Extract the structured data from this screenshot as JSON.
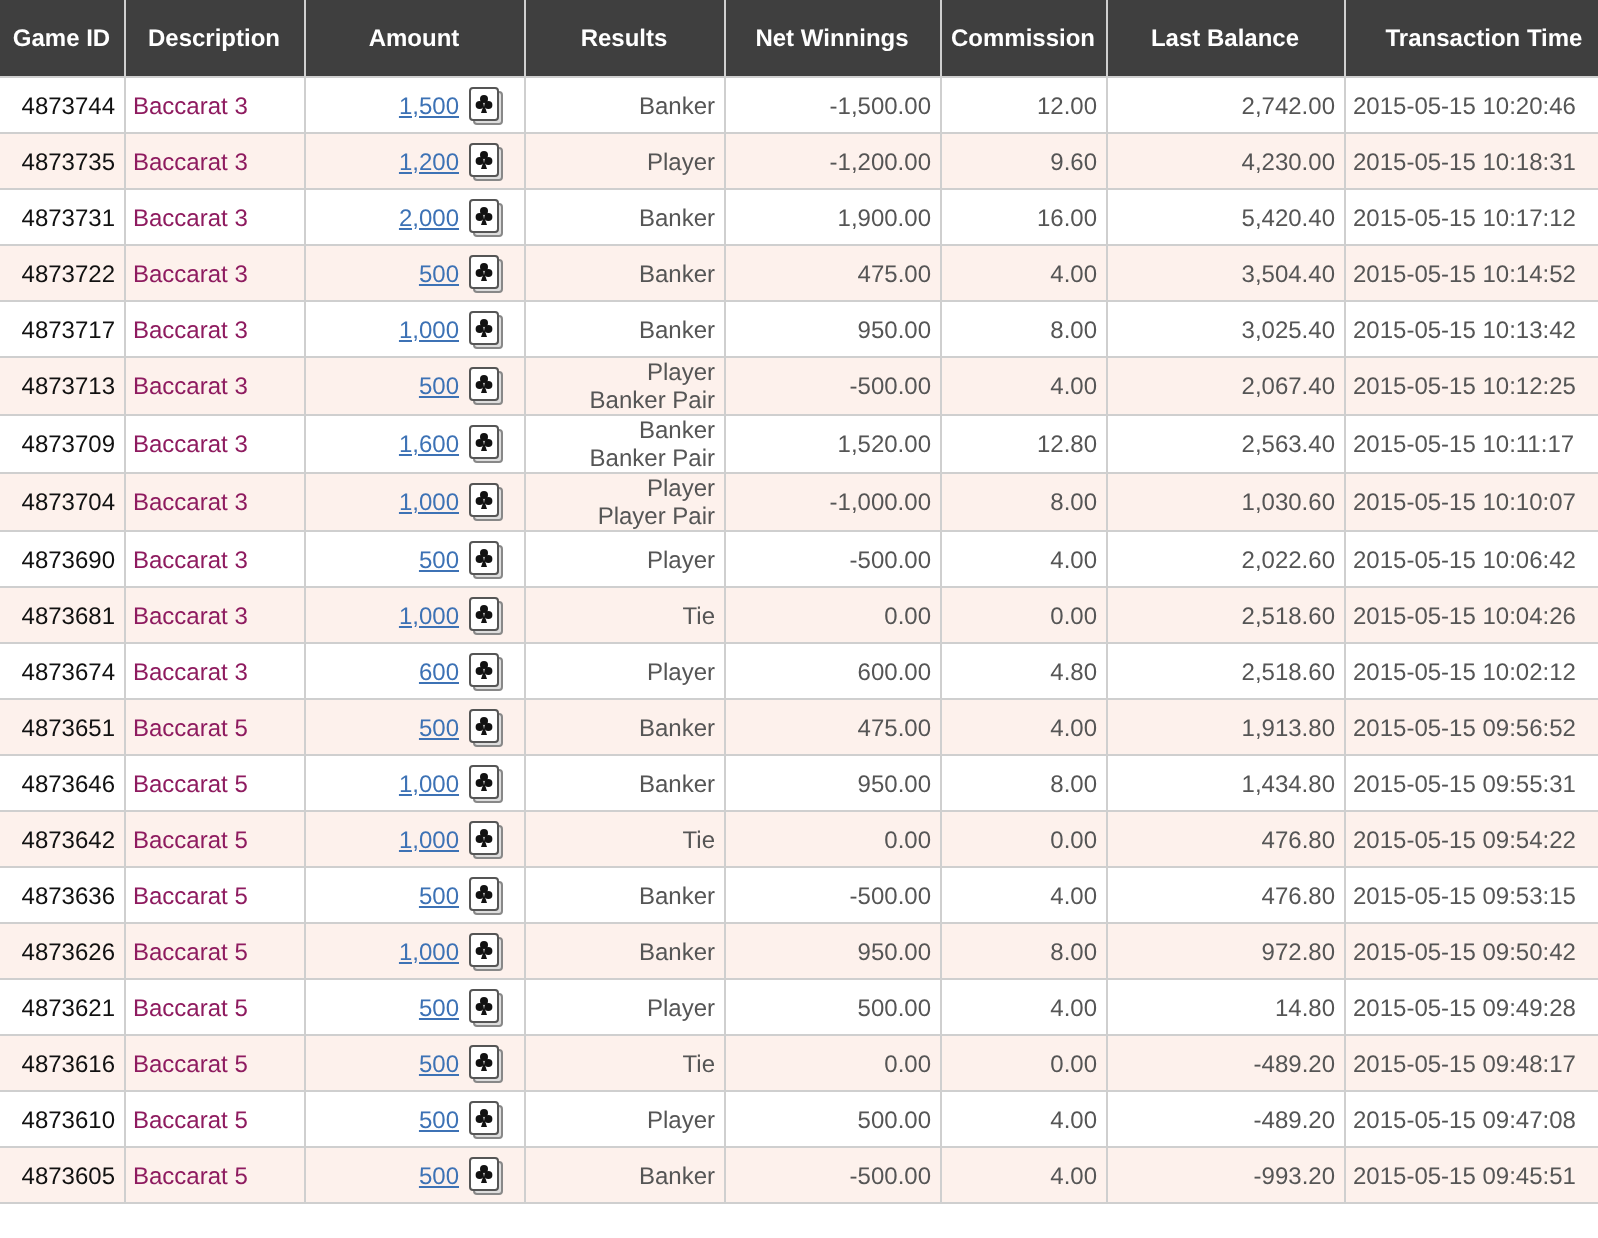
{
  "table": {
    "columns": [
      "Game ID",
      "Description",
      "Amount",
      "Results",
      "Net Winnings",
      "Commission",
      "Last Balance",
      "Transaction Time"
    ],
    "rows": [
      {
        "game_id": "4873744",
        "description": "Baccarat 3",
        "amount": "1,500",
        "results": "Banker",
        "net_winnings": "-1,500.00",
        "commission": "12.00",
        "last_balance": "2,742.00",
        "time": "2015-05-15 10:20:46"
      },
      {
        "game_id": "4873735",
        "description": "Baccarat 3",
        "amount": "1,200",
        "results": "Player",
        "net_winnings": "-1,200.00",
        "commission": "9.60",
        "last_balance": "4,230.00",
        "time": "2015-05-15 10:18:31"
      },
      {
        "game_id": "4873731",
        "description": "Baccarat 3",
        "amount": "2,000",
        "results": "Banker",
        "net_winnings": "1,900.00",
        "commission": "16.00",
        "last_balance": "5,420.40",
        "time": "2015-05-15 10:17:12"
      },
      {
        "game_id": "4873722",
        "description": "Baccarat 3",
        "amount": "500",
        "results": "Banker",
        "net_winnings": "475.00",
        "commission": "4.00",
        "last_balance": "3,504.40",
        "time": "2015-05-15 10:14:52"
      },
      {
        "game_id": "4873717",
        "description": "Baccarat 3",
        "amount": "1,000",
        "results": "Banker",
        "net_winnings": "950.00",
        "commission": "8.00",
        "last_balance": "3,025.40",
        "time": "2015-05-15 10:13:42"
      },
      {
        "game_id": "4873713",
        "description": "Baccarat 3",
        "amount": "500",
        "results": "Player\nBanker Pair",
        "net_winnings": "-500.00",
        "commission": "4.00",
        "last_balance": "2,067.40",
        "time": "2015-05-15 10:12:25"
      },
      {
        "game_id": "4873709",
        "description": "Baccarat 3",
        "amount": "1,600",
        "results": "Banker\nBanker Pair",
        "net_winnings": "1,520.00",
        "commission": "12.80",
        "last_balance": "2,563.40",
        "time": "2015-05-15 10:11:17"
      },
      {
        "game_id": "4873704",
        "description": "Baccarat 3",
        "amount": "1,000",
        "results": "Player\nPlayer Pair",
        "net_winnings": "-1,000.00",
        "commission": "8.00",
        "last_balance": "1,030.60",
        "time": "2015-05-15 10:10:07"
      },
      {
        "game_id": "4873690",
        "description": "Baccarat 3",
        "amount": "500",
        "results": "Player",
        "net_winnings": "-500.00",
        "commission": "4.00",
        "last_balance": "2,022.60",
        "time": "2015-05-15 10:06:42"
      },
      {
        "game_id": "4873681",
        "description": "Baccarat 3",
        "amount": "1,000",
        "results": "Tie",
        "net_winnings": "0.00",
        "commission": "0.00",
        "last_balance": "2,518.60",
        "time": "2015-05-15 10:04:26"
      },
      {
        "game_id": "4873674",
        "description": "Baccarat 3",
        "amount": "600",
        "results": "Player",
        "net_winnings": "600.00",
        "commission": "4.80",
        "last_balance": "2,518.60",
        "time": "2015-05-15 10:02:12"
      },
      {
        "game_id": "4873651",
        "description": "Baccarat 5",
        "amount": "500",
        "results": "Banker",
        "net_winnings": "475.00",
        "commission": "4.00",
        "last_balance": "1,913.80",
        "time": "2015-05-15 09:56:52"
      },
      {
        "game_id": "4873646",
        "description": "Baccarat 5",
        "amount": "1,000",
        "results": "Banker",
        "net_winnings": "950.00",
        "commission": "8.00",
        "last_balance": "1,434.80",
        "time": "2015-05-15 09:55:31"
      },
      {
        "game_id": "4873642",
        "description": "Baccarat 5",
        "amount": "1,000",
        "results": "Tie",
        "net_winnings": "0.00",
        "commission": "0.00",
        "last_balance": "476.80",
        "time": "2015-05-15 09:54:22"
      },
      {
        "game_id": "4873636",
        "description": "Baccarat 5",
        "amount": "500",
        "results": "Banker",
        "net_winnings": "-500.00",
        "commission": "4.00",
        "last_balance": "476.80",
        "time": "2015-05-15 09:53:15"
      },
      {
        "game_id": "4873626",
        "description": "Baccarat 5",
        "amount": "1,000",
        "results": "Banker",
        "net_winnings": "950.00",
        "commission": "8.00",
        "last_balance": "972.80",
        "time": "2015-05-15 09:50:42"
      },
      {
        "game_id": "4873621",
        "description": "Baccarat 5",
        "amount": "500",
        "results": "Player",
        "net_winnings": "500.00",
        "commission": "4.00",
        "last_balance": "14.80",
        "time": "2015-05-15 09:49:28"
      },
      {
        "game_id": "4873616",
        "description": "Baccarat 5",
        "amount": "500",
        "results": "Tie",
        "net_winnings": "0.00",
        "commission": "0.00",
        "last_balance": "-489.20",
        "time": "2015-05-15 09:48:17"
      },
      {
        "game_id": "4873610",
        "description": "Baccarat 5",
        "amount": "500",
        "results": "Player",
        "net_winnings": "500.00",
        "commission": "4.00",
        "last_balance": "-489.20",
        "time": "2015-05-15 09:47:08"
      },
      {
        "game_id": "4873605",
        "description": "Baccarat 5",
        "amount": "500",
        "results": "Banker",
        "net_winnings": "-500.00",
        "commission": "4.00",
        "last_balance": "-993.20",
        "time": "2015-05-15 09:45:51"
      }
    ]
  }
}
